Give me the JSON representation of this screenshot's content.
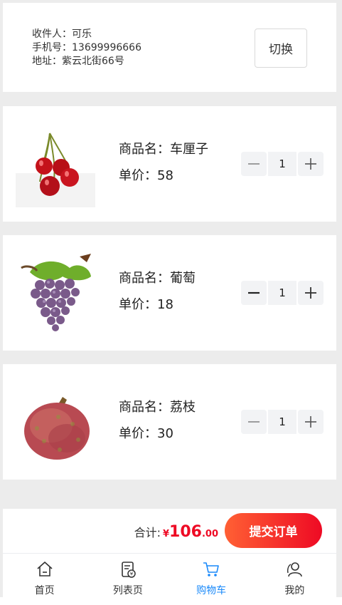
{
  "address": {
    "receiver_label": "收件人：",
    "receiver": "可乐",
    "phone_label": "手机号：",
    "phone": "13699996666",
    "address_label": "地址：",
    "address": "紫云北街66号",
    "switch_label": "切换"
  },
  "products": [
    {
      "name_label": "商品名：",
      "name": "车厘子",
      "price_label": "单价：",
      "price": "58",
      "quantity": "1",
      "image_icon": "cherry-image"
    },
    {
      "name_label": "商品名：",
      "name": "葡萄",
      "price_label": "单价：",
      "price": "18",
      "quantity": "1",
      "image_icon": "grape-image"
    },
    {
      "name_label": "商品名：",
      "name": "荔枝",
      "price_label": "单价：",
      "price": "30",
      "quantity": "1",
      "image_icon": "lychee-image"
    }
  ],
  "submit_bar": {
    "total_label": "合计:",
    "currency": "¥",
    "amount_int": "106",
    "amount_dec": ".00",
    "button_label": "提交订单",
    "accent_color": "#ee0a24"
  },
  "tabbar": {
    "items": [
      {
        "label": "首页",
        "icon": "home-icon"
      },
      {
        "label": "列表页",
        "icon": "list-icon"
      },
      {
        "label": "购物车",
        "icon": "cart-icon",
        "active": true
      },
      {
        "label": "我的",
        "icon": "user-icon"
      }
    ],
    "active_color": "#1989fa"
  }
}
